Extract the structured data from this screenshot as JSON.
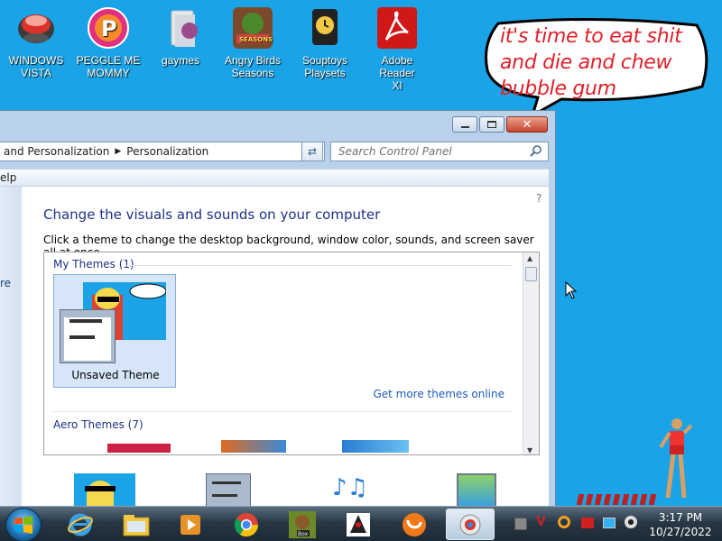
{
  "desktop": {
    "icons": [
      {
        "label": "WINDOWS\nVISTA",
        "icon": "vista-orb-icon"
      },
      {
        "label": "PEGGLE ME\nMOMMY",
        "icon": "peggle-icon"
      },
      {
        "label": "gaymes",
        "icon": "folder-icon"
      },
      {
        "label": "Angry Birds\nSeasons",
        "icon": "angry-birds-icon"
      },
      {
        "label": "Souptoys\nPlaysets",
        "icon": "souptoys-icon"
      },
      {
        "label": "Adobe Reader\nXI",
        "icon": "adobe-reader-icon"
      }
    ],
    "bubble_text": "it's time to eat shit and die and chew bubble gum"
  },
  "window": {
    "breadcrumb": [
      "and Personalization",
      "Personalization"
    ],
    "search_placeholder": "Search Control Panel",
    "menu_item": "elp",
    "left_pane_text": "re",
    "heading": "Change the visuals and sounds on your computer",
    "subtext": "Click a theme to change the desktop background, window color, sounds, and screen saver all at once.",
    "my_themes_label": "My Themes (1)",
    "theme_name": "Unsaved Theme",
    "get_more_link": "Get more themes online",
    "aero_themes_label": "Aero Themes (7)"
  },
  "taskbar": {
    "time": "3:17 PM",
    "date": "10/27/2022",
    "pinned": [
      "windows-start-icon",
      "internet-explorer-icon",
      "file-explorer-icon",
      "media-player-icon",
      "chrome-icon",
      "box-game-icon",
      "java-duke-icon",
      "uc-browser-icon",
      "control-panel-personalization-icon"
    ]
  },
  "colors": {
    "desktop_bg": "#1aa3e6",
    "heading": "#1e3287",
    "link": "#1e5bbf",
    "bubble_text": "#e0202a"
  }
}
